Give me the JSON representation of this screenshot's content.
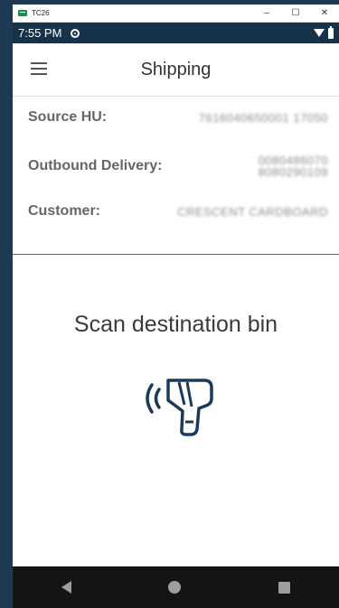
{
  "window": {
    "title": "TC26",
    "minimize": "–",
    "maximize": "☐",
    "close": "✕",
    "accent": "#1f8a4c"
  },
  "status_bar": {
    "time": "7:55 PM",
    "bg_color": "#17334b"
  },
  "header": {
    "title": "Shipping",
    "menu_icon": "hamburger-menu-icon"
  },
  "info": {
    "rows": [
      {
        "label": "Source HU:",
        "value": "7616040650001 17050"
      },
      {
        "label": "Outbound Delivery:",
        "value": "0080486070\n8080290109"
      },
      {
        "label": "Customer:",
        "value": "CRESCENT CARDBOARD"
      }
    ]
  },
  "main": {
    "prompt": "Scan destination bin",
    "icon": "barcode-scanner-icon",
    "icon_color": "#1c3a56"
  },
  "nav": {
    "back_icon": "back-triangle-icon",
    "home_icon": "home-circle-icon",
    "recents_icon": "recents-square-icon"
  }
}
